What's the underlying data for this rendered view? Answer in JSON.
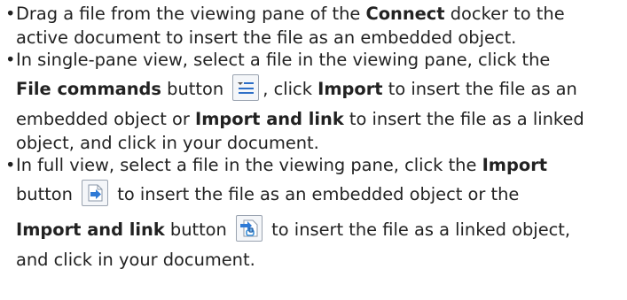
{
  "bullet_char": "•",
  "items": [
    {
      "l1": {
        "a": "Drag a file from the viewing pane of the ",
        "b": "Connect",
        "c": " docker to the"
      },
      "l2": "active document to insert the file as an embedded object."
    },
    {
      "l1": "In single-pane view, select a file in the viewing pane, click the",
      "l2": {
        "b1": "File commands",
        "a": " button ",
        "c": ", click ",
        "b2": "Import",
        "d": " to insert the file as an"
      },
      "l3": {
        "a": "embedded object or ",
        "b": "Import and link",
        "c": " to insert the file as a linked"
      },
      "l4": "object, and click in your document.",
      "icon": "file-commands-icon"
    },
    {
      "l1": {
        "a": "In full view, select a file in the viewing pane, click the ",
        "b": "Import"
      },
      "l2": {
        "a": "button ",
        "c": " to insert the file as an embedded object or the"
      },
      "l3": {
        "b": "Import and link",
        "a": " button ",
        "c": " to insert the file as a linked object,"
      },
      "l4": "and click in your document.",
      "icons": [
        "import-icon",
        "import-and-link-icon"
      ]
    }
  ]
}
